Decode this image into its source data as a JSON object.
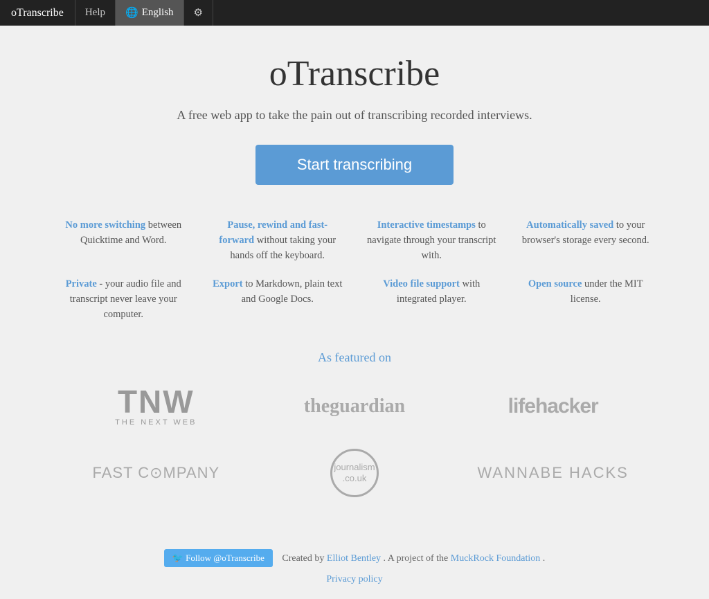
{
  "nav": {
    "brand": "oTranscribe",
    "help": "Help",
    "language": "English",
    "settings_icon": "⚙"
  },
  "main": {
    "title": "oTranscribe",
    "tagline": "A free web app to take the pain out of transcribing recorded interviews.",
    "start_button": "Start transcribing"
  },
  "features": [
    {
      "title": "No more switching",
      "title_suffix": "",
      "body": "between Quicktime and Word."
    },
    {
      "title": "Pause, rewind and fast-forward",
      "title_suffix": "",
      "body": "without taking your hands off the keyboard."
    },
    {
      "title": "Interactive timestamps",
      "title_suffix": "",
      "body": "to navigate through your transcript with."
    },
    {
      "title": "Automatically saved",
      "title_suffix": "",
      "body": "to your browser's storage every second."
    },
    {
      "title": "Private",
      "title_suffix": "",
      "body": "- your audio file and transcript never leave your computer."
    },
    {
      "title": "Export",
      "title_suffix": "",
      "body": "to Markdown, plain text and Google Docs."
    },
    {
      "title": "Video file support",
      "title_suffix": "",
      "body": "with integrated player."
    },
    {
      "title": "Open source",
      "title_suffix": "",
      "body": "under the MIT license."
    }
  ],
  "featured": {
    "label": "As featured on",
    "logos": [
      {
        "name": "TNW - The Next Web",
        "key": "tnw"
      },
      {
        "name": "The Guardian",
        "key": "guardian"
      },
      {
        "name": "Lifehacker",
        "key": "lifehacker"
      },
      {
        "name": "Fast Company",
        "key": "fastcompany"
      },
      {
        "name": "journalism.co.uk",
        "key": "journalism"
      },
      {
        "name": "Wannabe Hacks",
        "key": "wannabe"
      }
    ]
  },
  "footer": {
    "twitter_button": "Follow @oTranscribe",
    "created_by": "Created by",
    "creator": "Elliot Bentley",
    "project_of": ". A project of the",
    "foundation": "MuckRock Foundation",
    "period": ".",
    "privacy_policy": "Privacy policy"
  }
}
